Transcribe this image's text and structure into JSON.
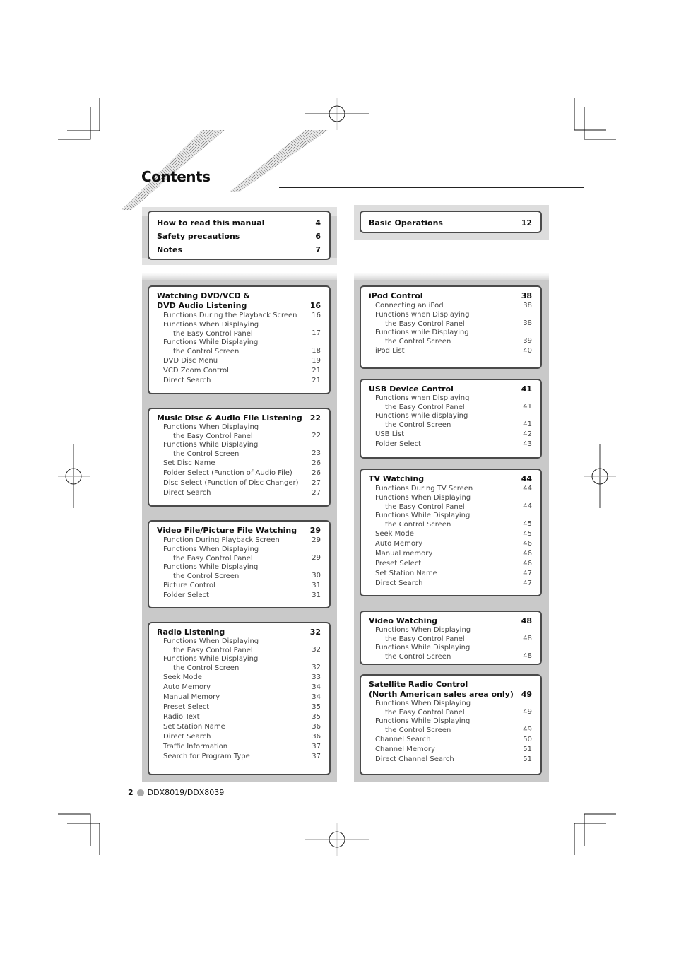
{
  "page": {
    "title": "Contents",
    "footer": {
      "page_number": "2",
      "model": "DDX8019/DDX8039"
    }
  },
  "colors": {
    "panel_bg": "#c9c9c9",
    "box_border": "#4a4a4a",
    "text": "#111111",
    "sub_text": "#444444"
  },
  "intro_box": {
    "items": [
      {
        "label": "How to read this manual",
        "page": "4"
      },
      {
        "label": "Safety precautions",
        "page": "6"
      },
      {
        "label": "Notes",
        "page": "7"
      }
    ]
  },
  "basic_box": {
    "items": [
      {
        "label": "Basic Operations",
        "page": "12"
      }
    ]
  },
  "left_sections": [
    {
      "heading": "Watching DVD/VCD &\n DVD Audio Listening",
      "page": "16",
      "items": [
        {
          "label": "Functions During the Playback Screen",
          "page": "16"
        },
        {
          "label": "Functions When Displaying",
          "label2": "the Easy Control Panel",
          "page": "17"
        },
        {
          "label": "Functions While Displaying",
          "label2": "the Control Screen",
          "page": "18"
        },
        {
          "label": "DVD Disc Menu",
          "page": "19"
        },
        {
          "label": "VCD Zoom Control",
          "page": "21"
        },
        {
          "label": "Direct Search",
          "page": "21"
        }
      ]
    },
    {
      "heading": "Music Disc & Audio File Listening",
      "page": "22",
      "items": [
        {
          "label": "Functions When Displaying",
          "label2": "the Easy Control Panel",
          "page": "22"
        },
        {
          "label": "Functions While Displaying",
          "label2": "the Control Screen",
          "page": "23"
        },
        {
          "label": "Set Disc Name",
          "page": "26"
        },
        {
          "label": "Folder Select (Function of Audio File)",
          "page": "26"
        },
        {
          "label": "Disc Select (Function of Disc Changer)",
          "page": "27"
        },
        {
          "label": "Direct Search",
          "page": "27"
        }
      ]
    },
    {
      "heading": "Video File/Picture File Watching",
      "page": "29",
      "items": [
        {
          "label": "Function During Playback Screen",
          "page": "29"
        },
        {
          "label": "Functions When Displaying",
          "label2": "the Easy Control Panel",
          "page": "29"
        },
        {
          "label": "Functions While Displaying",
          "label2": "the Control Screen",
          "page": "30"
        },
        {
          "label": "Picture Control",
          "page": "31"
        },
        {
          "label": "Folder Select",
          "page": "31"
        }
      ]
    },
    {
      "heading": "Radio Listening",
      "page": "32",
      "items": [
        {
          "label": "Functions When Displaying",
          "label2": "the Easy Control Panel",
          "page": "32"
        },
        {
          "label": "Functions While Displaying",
          "label2": "the Control Screen",
          "page": "32"
        },
        {
          "label": "Seek Mode",
          "page": "33"
        },
        {
          "label": "Auto Memory",
          "page": "34"
        },
        {
          "label": "Manual Memory",
          "page": "34"
        },
        {
          "label": "Preset Select",
          "page": "35"
        },
        {
          "label": "Radio Text",
          "page": "35"
        },
        {
          "label": "Set Station Name",
          "page": "36"
        },
        {
          "label": "Direct Search",
          "page": "36"
        },
        {
          "label": "Traffic Information",
          "page": "37"
        },
        {
          "label": "Search for Program Type",
          "page": "37"
        }
      ]
    }
  ],
  "right_sections": [
    {
      "heading": "iPod Control",
      "page": "38",
      "items": [
        {
          "label": "Connecting an iPod",
          "page": "38"
        },
        {
          "label": "Functions when Displaying",
          "label2": "the Easy Control Panel",
          "page": "38"
        },
        {
          "label": "Functions while Displaying",
          "label2": "the Control Screen",
          "page": "39"
        },
        {
          "label": "iPod List",
          "page": "40"
        }
      ]
    },
    {
      "heading": "USB Device Control",
      "page": "41",
      "items": [
        {
          "label": "Functions when Displaying",
          "label2": "the Easy Control Panel",
          "page": "41"
        },
        {
          "label": "Functions while displaying",
          "label2": "the Control Screen",
          "page": "41"
        },
        {
          "label": "USB List",
          "page": "42"
        },
        {
          "label": "Folder Select",
          "page": "43"
        }
      ]
    },
    {
      "heading": "TV Watching",
      "page": "44",
      "items": [
        {
          "label": "Functions During TV Screen",
          "page": "44"
        },
        {
          "label": "Functions When Displaying",
          "label2": "the Easy Control Panel",
          "page": "44"
        },
        {
          "label": "Functions While Displaying",
          "label2": "the Control Screen",
          "page": "45"
        },
        {
          "label": "Seek Mode",
          "page": "45"
        },
        {
          "label": "Auto Memory",
          "page": "46"
        },
        {
          "label": "Manual memory",
          "page": "46"
        },
        {
          "label": "Preset Select",
          "page": "46"
        },
        {
          "label": "Set Station Name",
          "page": "47"
        },
        {
          "label": "Direct Search",
          "page": "47"
        }
      ]
    },
    {
      "heading": "Video Watching",
      "page": "48",
      "items": [
        {
          "label": "Functions When Displaying",
          "label2": "the Easy Control Panel",
          "page": "48"
        },
        {
          "label": "Functions While Displaying",
          "label2": "the Control Screen",
          "page": "48"
        }
      ]
    },
    {
      "heading": "Satellite Radio Control\n(North American sales area only)",
      "page": "49",
      "items": [
        {
          "label": "Functions When Displaying",
          "label2": "the Easy Control Panel",
          "page": "49"
        },
        {
          "label": "Functions While Displaying",
          "label2": "the Control Screen",
          "page": "49"
        },
        {
          "label": "Channel Search",
          "page": "50"
        },
        {
          "label": "Channel Memory",
          "page": "51"
        },
        {
          "label": "Direct Channel Search",
          "page": "51"
        }
      ]
    }
  ]
}
